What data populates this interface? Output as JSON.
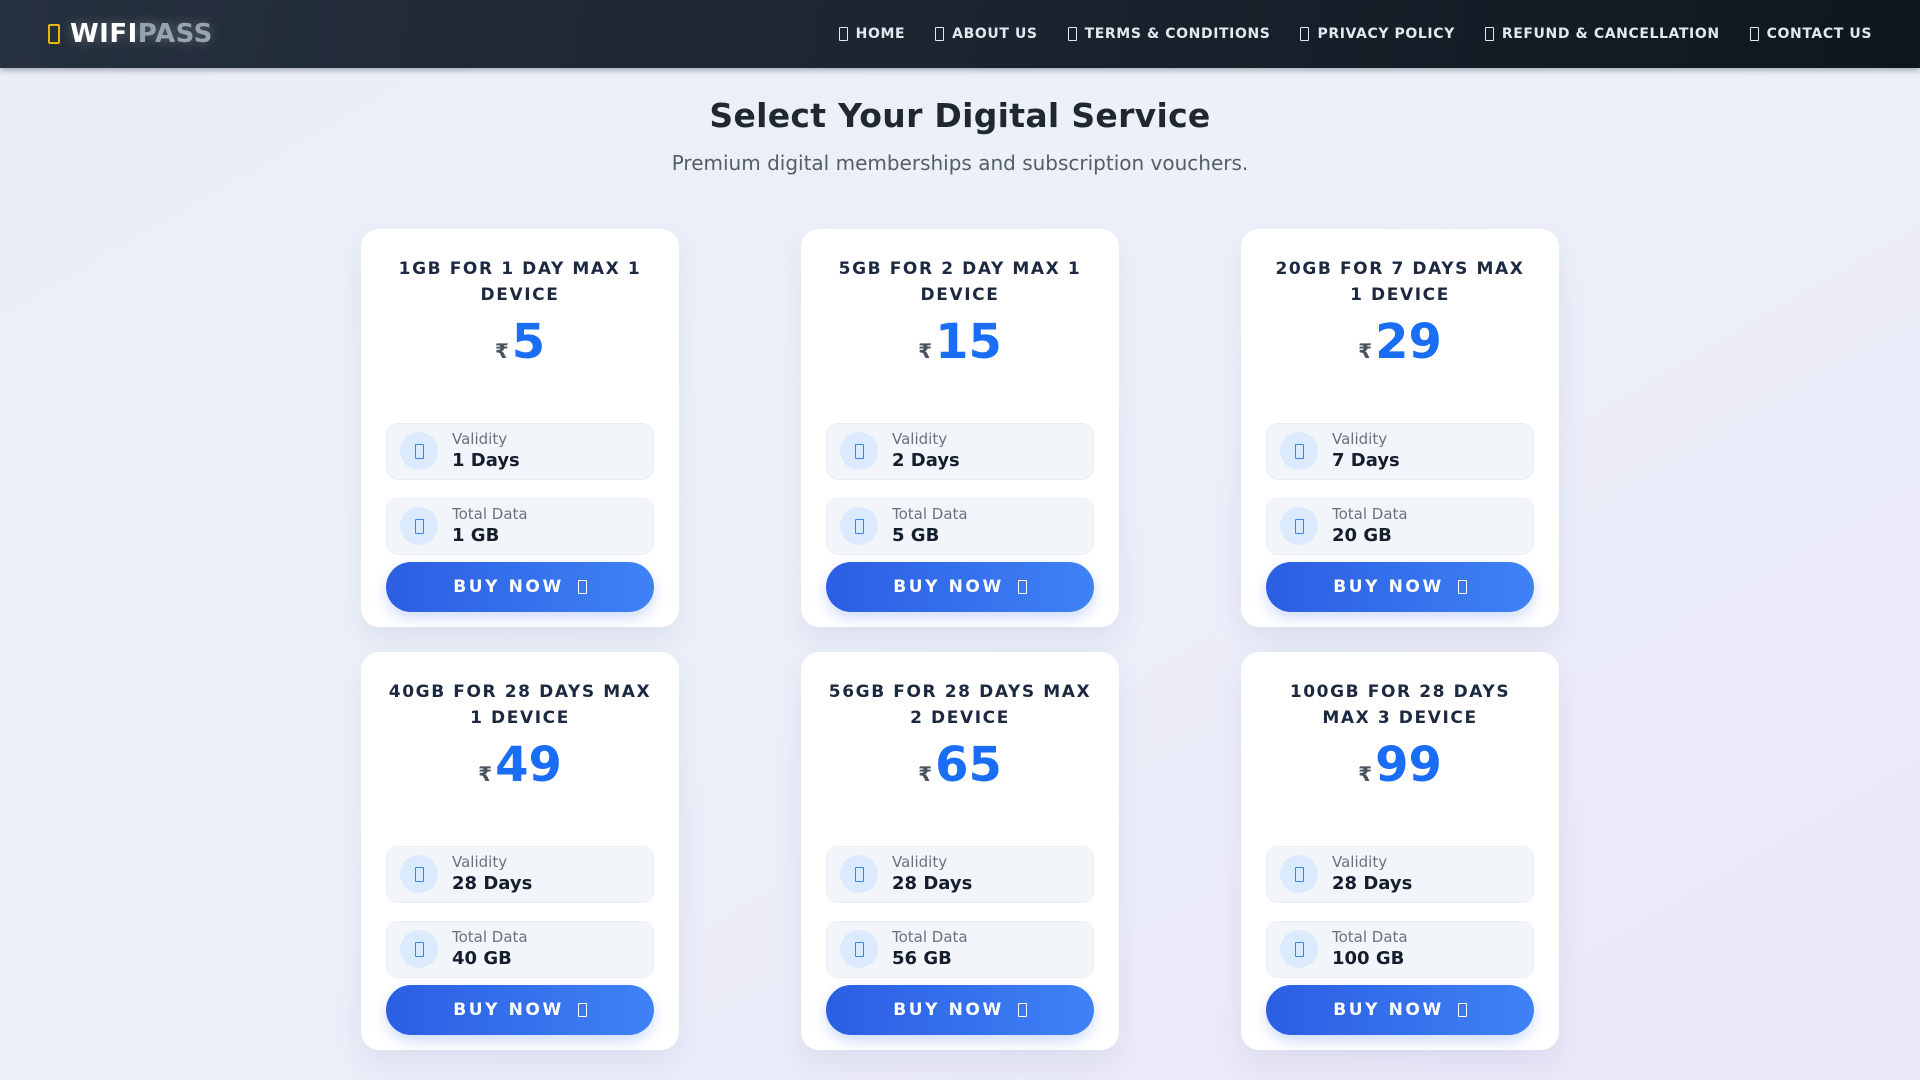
{
  "nav": {
    "brand": {
      "icon": "wifi",
      "name_primary": "WIFI",
      "name_secondary": "PASS"
    },
    "items": [
      {
        "label": "HOME"
      },
      {
        "label": "ABOUT US"
      },
      {
        "label": "TERMS & CONDITIONS"
      },
      {
        "label": "PRIVACY POLICY"
      },
      {
        "label": "REFUND & CANCELLATION"
      },
      {
        "label": "CONTACT US",
        "icon": "headset"
      }
    ]
  },
  "hero": {
    "title": "Select Your Digital Service",
    "subtitle": "Premium digital memberships and subscription vouchers."
  },
  "plans": {
    "currency": "₹",
    "validity_label": "Validity",
    "data_label": "Total Data",
    "buy_label": "BUY NOW",
    "cards": [
      {
        "title": "1GB FOR 1 DAY MAX 1 DEVICE",
        "price": "5",
        "validity": "1 Days",
        "data": "1 GB"
      },
      {
        "title": "5GB FOR 2 DAY MAX 1 DEVICE",
        "price": "15",
        "validity": "2 Days",
        "data": "5 GB"
      },
      {
        "title": "20GB FOR 7 DAYS MAX 1 DEVICE",
        "price": "29",
        "validity": "7 Days",
        "data": "20 GB"
      },
      {
        "title": "40GB FOR 28 DAYS MAX 1 DEVICE",
        "price": "49",
        "validity": "28 Days",
        "data": "40 GB"
      },
      {
        "title": "56GB FOR 28 DAYS MAX 2 DEVICE",
        "price": "65",
        "validity": "28 Days",
        "data": "56 GB"
      },
      {
        "title": "100GB FOR 28 DAYS MAX 3 DEVICE",
        "price": "99",
        "validity": "28 Days",
        "data": "100 GB"
      }
    ]
  },
  "colors": {
    "accent_blue": "#1a6df5",
    "brand_icon_yellow": "#e7b70c",
    "navbar_dark": "#1c2531",
    "icon_circle_bg": "#dbeafe"
  }
}
